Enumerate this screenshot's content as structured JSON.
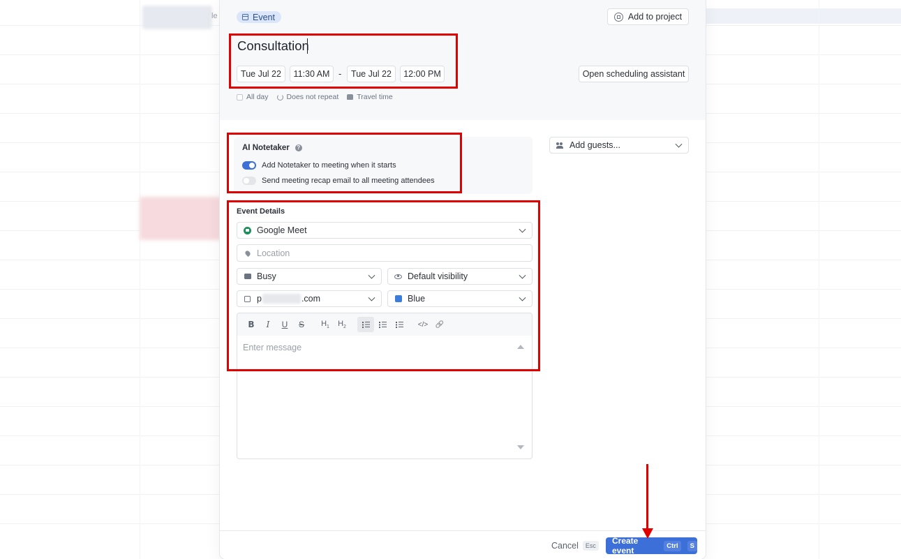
{
  "background": {
    "tag_text": "le"
  },
  "event_chip": "Event",
  "add_to_project": "Add to project",
  "title_value": "Consultation",
  "start_date": "Tue Jul 22",
  "start_time": "11:30 AM",
  "date_separator": "-",
  "end_date": "Tue Jul 22",
  "end_time": "12:00 PM",
  "open_scheduling": "Open scheduling assistant",
  "options": {
    "all_day": "All day",
    "repeat": "Does not repeat",
    "travel": "Travel time"
  },
  "notetaker": {
    "title": "AI Notetaker",
    "help": "?",
    "row1": {
      "label": "Add Notetaker to meeting when it starts",
      "on": true
    },
    "row2": {
      "label": "Send meeting recap email to all meeting attendees",
      "on": false
    }
  },
  "guests_placeholder": "Add guests...",
  "event_details": {
    "label": "Event Details",
    "conference": "Google Meet",
    "location_placeholder": "Location",
    "availability": "Busy",
    "visibility": "Default visibility",
    "calendar_prefix": "p",
    "calendar_suffix": ".com",
    "color": "Blue",
    "message_placeholder": "Enter message"
  },
  "toolbar": {
    "bold": "B",
    "italic": "I",
    "underline": "U",
    "strike": "S",
    "h1": "H",
    "h1_sub": "1",
    "h2": "H",
    "h2_sub": "2",
    "code": "</>",
    "link": "🔗"
  },
  "footer": {
    "cancel": "Cancel",
    "cancel_kbd": "Esc",
    "create": "Create event",
    "create_kbd1": "Ctrl",
    "create_kbd2": "S"
  },
  "colors": {
    "accent": "#3c6fd8",
    "annotation": "#e00000",
    "calendar_blue": "#3b7ddd"
  }
}
